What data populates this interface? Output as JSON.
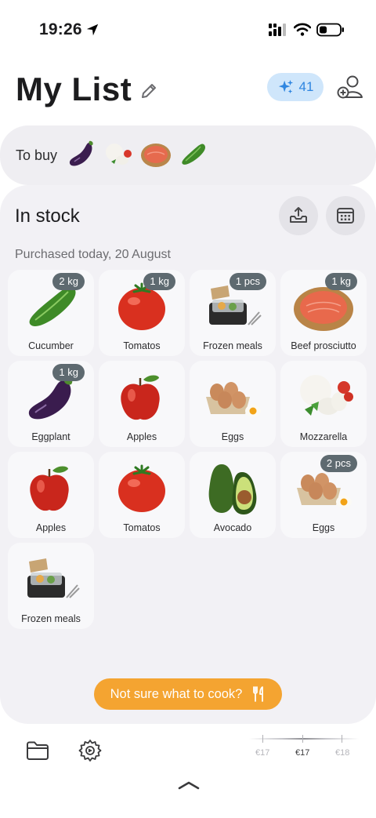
{
  "status_bar": {
    "time": "19:26"
  },
  "header": {
    "title": "My List",
    "ai_count": "41"
  },
  "to_buy": {
    "label": "To buy",
    "items": [
      "eggplant-icon",
      "mozzarella-icon",
      "prosciutto-icon",
      "cucumber-icon"
    ]
  },
  "in_stock": {
    "heading": "In stock",
    "date_label": "Purchased today, 20 August",
    "items": [
      {
        "name": "Cucumber",
        "qty": "2 kg",
        "icon": "cucumber-icon"
      },
      {
        "name": "Tomatos",
        "qty": "1 kg",
        "icon": "tomato-icon"
      },
      {
        "name": "Frozen meals",
        "qty": "1 pcs",
        "icon": "frozen-meal-icon"
      },
      {
        "name": "Beef prosciutto",
        "qty": "1 kg",
        "icon": "prosciutto-icon"
      },
      {
        "name": "Eggplant",
        "qty": "1 kg",
        "icon": "eggplant-icon"
      },
      {
        "name": "Apples",
        "qty": "",
        "icon": "apple-icon"
      },
      {
        "name": "Eggs",
        "qty": "",
        "icon": "eggs-icon"
      },
      {
        "name": "Mozzarella",
        "qty": "",
        "icon": "mozzarella-icon"
      },
      {
        "name": "Apples",
        "qty": "",
        "icon": "apple-icon"
      },
      {
        "name": "Tomatos",
        "qty": "",
        "icon": "tomato-icon"
      },
      {
        "name": "Avocado",
        "qty": "",
        "icon": "avocado-icon"
      },
      {
        "name": "Eggs",
        "qty": "2 pcs",
        "icon": "eggs-icon"
      },
      {
        "name": "Frozen meals",
        "qty": "",
        "icon": "frozen-meal-icon"
      }
    ]
  },
  "cook_button": {
    "label": "Not sure what to cook?"
  },
  "price_scale": {
    "labels": [
      "€17",
      "€17",
      "€18"
    ],
    "active_index": 1
  },
  "colors": {
    "accent_orange": "#f4a431",
    "ai_badge_bg": "#cfe6fb",
    "ai_badge_text": "#2f86e0",
    "qty_badge": "#5e6a70"
  }
}
